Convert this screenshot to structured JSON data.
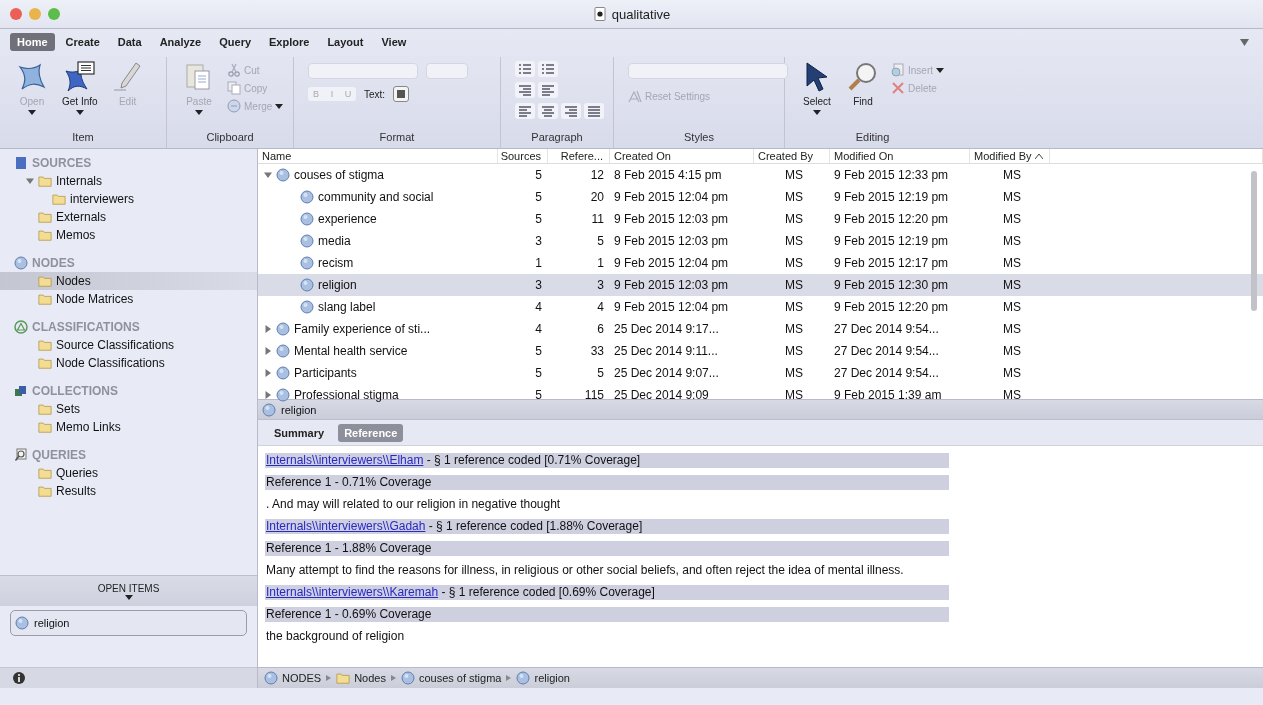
{
  "window": {
    "title": "qualitative"
  },
  "ribbon": {
    "tabs": [
      {
        "label": "Home",
        "selected": true
      },
      {
        "label": "Create",
        "selected": false
      },
      {
        "label": "Data",
        "selected": false
      },
      {
        "label": "Analyze",
        "selected": false
      },
      {
        "label": "Query",
        "selected": false
      },
      {
        "label": "Explore",
        "selected": false
      },
      {
        "label": "Layout",
        "selected": false
      },
      {
        "label": "View",
        "selected": false
      }
    ],
    "groups": [
      {
        "title": "Item",
        "controls": [
          {
            "kind": "large",
            "label": "Open",
            "disabled": true,
            "menu": true
          },
          {
            "kind": "large",
            "label": "Get Info",
            "disabled": false,
            "menu": true
          },
          {
            "kind": "large",
            "label": "Edit",
            "disabled": true,
            "menu": false
          }
        ]
      },
      {
        "title": "Clipboard",
        "controls": [
          {
            "kind": "large",
            "label": "Paste",
            "disabled": true,
            "menu": true
          },
          {
            "kind": "stack",
            "items": [
              {
                "label": "Cut",
                "disabled": true,
                "menu": false
              },
              {
                "label": "Copy",
                "disabled": true,
                "menu": false
              },
              {
                "label": "Merge",
                "disabled": true,
                "menu": true
              }
            ]
          }
        ]
      },
      {
        "title": "Format",
        "controls": [
          {
            "kind": "format",
            "styles": [
              "B",
              "I",
              "U"
            ],
            "color_label": "Text:"
          }
        ]
      },
      {
        "title": "Paragraph",
        "controls": [
          {
            "kind": "paragraph"
          }
        ]
      },
      {
        "title": "Styles",
        "controls": [
          {
            "kind": "styles",
            "items": [
              {
                "label": "Reset Settings",
                "disabled": true,
                "menu": false
              }
            ]
          }
        ]
      },
      {
        "title": "Editing",
        "controls": [
          {
            "kind": "large",
            "label": "Select",
            "disabled": false,
            "menu": true
          },
          {
            "kind": "large",
            "label": "Find",
            "disabled": false,
            "menu": false
          },
          {
            "kind": "stack",
            "items": [
              {
                "label": "Insert",
                "disabled": true,
                "menu": true
              },
              {
                "label": "Delete",
                "disabled": true,
                "menu": false
              }
            ]
          }
        ]
      }
    ]
  },
  "sidebar": {
    "sections": [
      {
        "title": "SOURCES",
        "kind": "sources",
        "items": [
          {
            "label": "Internals",
            "selected": false,
            "expanded": true,
            "children": [
              {
                "label": "interviewers",
                "selected": false
              }
            ]
          },
          {
            "label": "Externals",
            "selected": false
          },
          {
            "label": "Memos",
            "selected": false
          }
        ]
      },
      {
        "title": "NODES",
        "kind": "nodes",
        "items": [
          {
            "label": "Nodes",
            "selected": true
          },
          {
            "label": "Node Matrices",
            "selected": false
          }
        ]
      },
      {
        "title": "CLASSIFICATIONS",
        "kind": "classifications",
        "items": [
          {
            "label": "Source Classifications",
            "selected": false
          },
          {
            "label": "Node Classifications",
            "selected": false
          }
        ]
      },
      {
        "title": "COLLECTIONS",
        "kind": "collections",
        "items": [
          {
            "label": "Sets",
            "selected": false
          },
          {
            "label": "Memo Links",
            "selected": false
          }
        ]
      },
      {
        "title": "QUERIES",
        "kind": "queries",
        "items": [
          {
            "label": "Queries",
            "selected": false
          },
          {
            "label": "Results",
            "selected": false
          }
        ]
      }
    ],
    "open_items": {
      "label": "OPEN ITEMS",
      "items": [
        {
          "label": "religion"
        }
      ]
    }
  },
  "table": {
    "columns": [
      {
        "label": "Name",
        "sorted": false
      },
      {
        "label": "Sources",
        "sorted": false
      },
      {
        "label": "Refere...",
        "sorted": false
      },
      {
        "label": "Created On",
        "sorted": false
      },
      {
        "label": "Created By",
        "sorted": false
      },
      {
        "label": "Modified On",
        "sorted": false
      },
      {
        "label": "Modified By",
        "sorted": true
      }
    ],
    "rows": [
      {
        "name": "couses of stigma",
        "sources": "5",
        "references": "12",
        "created_on": "8 Feb 2015 4:15 pm",
        "created_by": "MS",
        "modified_on": "9 Feb 2015 12:33 pm",
        "modified_by": "MS",
        "selected": false,
        "expanded": true,
        "children": [
          {
            "name": "community and social",
            "sources": "5",
            "references": "20",
            "created_on": "9 Feb 2015 12:04 pm",
            "created_by": "MS",
            "modified_on": "9 Feb 2015 12:19 pm",
            "modified_by": "MS",
            "selected": false
          },
          {
            "name": "experience",
            "sources": "5",
            "references": "11",
            "created_on": "9 Feb 2015 12:03 pm",
            "created_by": "MS",
            "modified_on": "9 Feb 2015 12:20 pm",
            "modified_by": "MS",
            "selected": false
          },
          {
            "name": "media",
            "sources": "3",
            "references": "5",
            "created_on": "9 Feb 2015 12:03 pm",
            "created_by": "MS",
            "modified_on": "9 Feb 2015 12:19 pm",
            "modified_by": "MS",
            "selected": false
          },
          {
            "name": "recism",
            "sources": "1",
            "references": "1",
            "created_on": "9 Feb 2015 12:04 pm",
            "created_by": "MS",
            "modified_on": "9 Feb 2015 12:17 pm",
            "modified_by": "MS",
            "selected": false
          },
          {
            "name": "religion",
            "sources": "3",
            "references": "3",
            "created_on": "9 Feb 2015 12:03 pm",
            "created_by": "MS",
            "modified_on": "9 Feb 2015 12:30 pm",
            "modified_by": "MS",
            "selected": true
          },
          {
            "name": "slang label",
            "sources": "4",
            "references": "4",
            "created_on": "9 Feb 2015 12:04 pm",
            "created_by": "MS",
            "modified_on": "9 Feb 2015 12:20 pm",
            "modified_by": "MS",
            "selected": false
          }
        ]
      },
      {
        "name": "Family experience of sti...",
        "sources": "4",
        "references": "6",
        "created_on": "25 Dec 2014 9:17...",
        "created_by": "MS",
        "modified_on": "27 Dec 2014 9:54...",
        "modified_by": "MS",
        "selected": false,
        "expanded": false
      },
      {
        "name": "Mental health service",
        "sources": "5",
        "references": "33",
        "created_on": "25 Dec 2014 9:11...",
        "created_by": "MS",
        "modified_on": "27 Dec 2014 9:54...",
        "modified_by": "MS",
        "selected": false,
        "expanded": false
      },
      {
        "name": "Participants",
        "sources": "5",
        "references": "5",
        "created_on": "25 Dec 2014 9:07...",
        "created_by": "MS",
        "modified_on": "27 Dec 2014 9:54...",
        "modified_by": "MS",
        "selected": false,
        "expanded": false
      },
      {
        "name": "Professional stigma",
        "sources": "5",
        "references": "115",
        "created_on": "25 Dec 2014 9:09",
        "created_by": "MS",
        "modified_on": "9 Feb 2015 1:39 am",
        "modified_by": "MS",
        "selected": false,
        "expanded": false
      }
    ]
  },
  "detail": {
    "title": "religion",
    "tabs": [
      {
        "label": "Summary",
        "selected": false
      },
      {
        "label": "Reference",
        "selected": true
      }
    ],
    "blocks": [
      {
        "kind": "source",
        "link": "Internals\\\\interviewers\\\\Elham",
        "text": " - § 1 reference coded [0.71% Coverage]"
      },
      {
        "kind": "reference",
        "text": "Reference 1 - 0.71% Coverage"
      },
      {
        "kind": "text",
        "text": ". And may will related to our religion in negative thought"
      },
      {
        "kind": "source",
        "link": "Internals\\\\interviewers\\\\Gadah",
        "text": " - § 1 reference coded [1.88% Coverage]"
      },
      {
        "kind": "reference",
        "text": "Reference 1 - 1.88% Coverage"
      },
      {
        "kind": "text",
        "text": "Many attempt to find the reasons for illness, in religious or other social beliefs, and often reject the idea of mental illness."
      },
      {
        "kind": "source",
        "link": "Internals\\\\interviewers\\\\Karemah",
        "text": " - § 1 reference coded [0.69% Coverage]"
      },
      {
        "kind": "reference",
        "text": "Reference 1 - 0.69% Coverage"
      },
      {
        "kind": "text",
        "text": "the background of religion"
      }
    ]
  },
  "breadcrumb": [
    {
      "kind": "node",
      "label": "NODES"
    },
    {
      "kind": "folder",
      "label": "Nodes"
    },
    {
      "kind": "node",
      "label": "couses of stigma"
    },
    {
      "kind": "node",
      "label": "religion"
    }
  ]
}
